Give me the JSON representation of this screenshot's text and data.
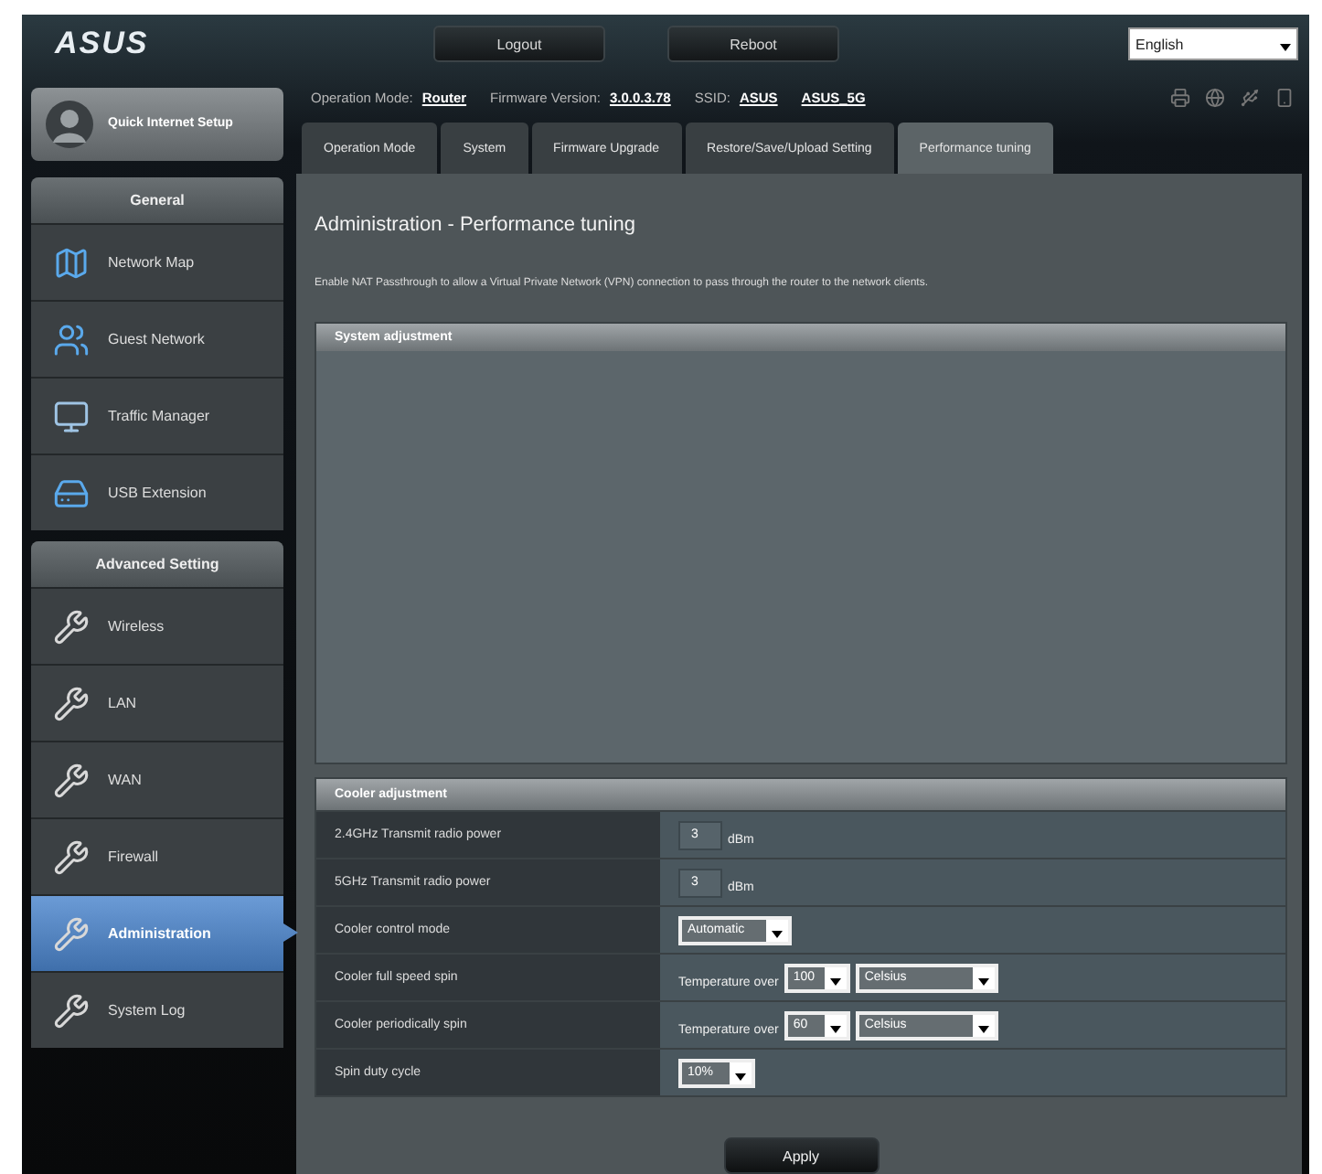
{
  "header": {
    "logo": "ASUS",
    "buttons": [
      {
        "label": "Logout"
      },
      {
        "label": "Reboot"
      }
    ],
    "language": {
      "value": "English"
    }
  },
  "quick_setup": {
    "label": "Quick Internet Setup"
  },
  "sidebar": {
    "sections": [
      {
        "title": "General",
        "items": [
          {
            "label": "Network Map",
            "kind": "map",
            "selected": false
          },
          {
            "label": "Guest Network",
            "kind": "guests",
            "selected": false
          },
          {
            "label": "Traffic Manager",
            "kind": "traffic",
            "selected": false
          },
          {
            "label": "USB Extension",
            "kind": "usb",
            "selected": false
          }
        ]
      },
      {
        "title": "Advanced Setting",
        "items": [
          {
            "label": "Wireless",
            "kind": "wrench",
            "selected": false
          },
          {
            "label": "LAN",
            "kind": "wrench",
            "selected": false
          },
          {
            "label": "WAN",
            "kind": "wrench",
            "selected": false
          },
          {
            "label": "Firewall",
            "kind": "wrench",
            "selected": false
          },
          {
            "label": "Administration",
            "kind": "wrench",
            "selected": true
          },
          {
            "label": "System Log",
            "kind": "wrench",
            "selected": false
          }
        ]
      }
    ]
  },
  "status": [
    {
      "label": "Operation Mode:",
      "value": "Router"
    },
    {
      "label": "Firmware Version:",
      "value": "3.0.0.3.78"
    },
    {
      "label": "SSID:",
      "value": "ASUS"
    },
    {
      "value": "ASUS_5G"
    }
  ],
  "tabs": [
    {
      "label": "Operation Mode",
      "selected": false
    },
    {
      "label": "System",
      "selected": false
    },
    {
      "label": "Firmware Upgrade",
      "selected": false
    },
    {
      "label": "Restore/Save/Upload Setting",
      "selected": false
    },
    {
      "label": "Performance tuning",
      "selected": true
    }
  ],
  "page": {
    "title": "Administration - Performance tuning",
    "description": "Enable NAT Passthrough to allow a Virtual Private Network (VPN) connection to pass through the router to the network clients.",
    "sections": [
      {
        "title": "System adjustment"
      },
      {
        "title": "Cooler adjustment",
        "rows": [
          {
            "kind": "power",
            "label": "2.4GHz Transmit radio power",
            "value": "3",
            "unit": "dBm"
          },
          {
            "kind": "power",
            "label": "5GHz Transmit radio power",
            "value": "3",
            "unit": "dBm"
          },
          {
            "kind": "select",
            "label": "Cooler control mode",
            "value": "Automatic"
          },
          {
            "kind": "temperature",
            "label": "Cooler full speed spin",
            "prefix": "Temperature over",
            "value": "100",
            "unit": "Celsius"
          },
          {
            "kind": "temperature",
            "label": "Cooler periodically spin",
            "prefix": "Temperature over",
            "value": "60",
            "unit": "Celsius"
          },
          {
            "kind": "select",
            "label": "Spin duty cycle",
            "value": "10%"
          }
        ]
      }
    ]
  },
  "apply": {
    "label": "Apply"
  }
}
